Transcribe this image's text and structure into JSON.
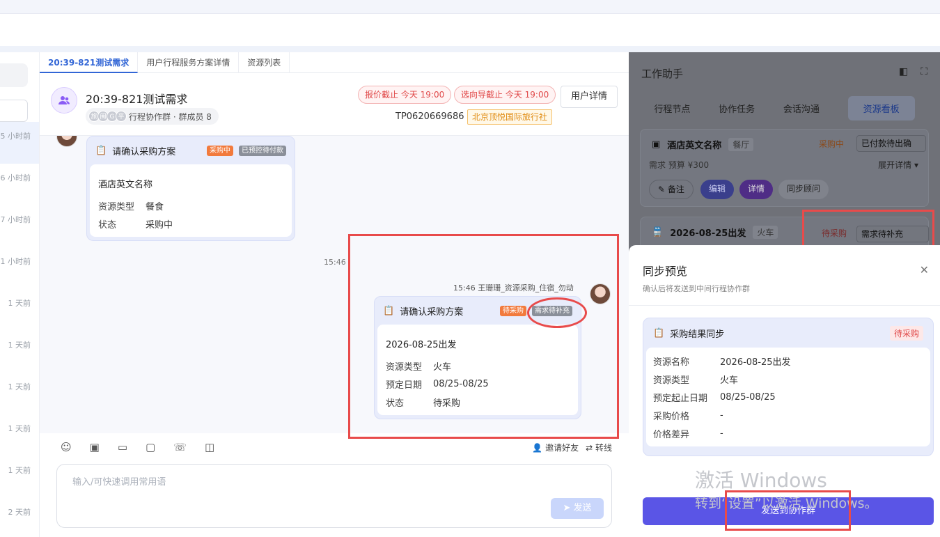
{
  "left_list": {
    "times": [
      "5 小时前",
      "6 小时前",
      "7 小时前",
      "1 小时前",
      "1 天前",
      "1 天前",
      "1 天前",
      "1 天前",
      "1 天前",
      "2 天前"
    ]
  },
  "tabs": [
    "20:39-821测试需求",
    "用户行程服务方案详情",
    "资源列表"
  ],
  "header": {
    "title": "20:39-821测试需求",
    "member_avatars": [
      "旅",
      "闽",
      "G",
      "平"
    ],
    "members": "行程协作群 · 群成员 8",
    "quote_deadline": "报价截止 今天 19:00",
    "guide_deadline": "选向导截止 今天 19:00",
    "user_detail": "用户详情",
    "tp_code": "TP0620669686",
    "agency": "北京顶悦国际旅行社"
  },
  "msg1": {
    "title": "请确认采购方案",
    "tag1": "采购中",
    "tag2": "已预控待付款",
    "name": "酒店英文名称",
    "rows": [
      {
        "k": "资源类型",
        "v": "餐食"
      },
      {
        "k": "状态",
        "v": "采购中"
      }
    ]
  },
  "center_time": "15:46",
  "msg2": {
    "sender": "15:46 王珊珊_资源采购_住宿_勿动",
    "title": "请确认采购方案",
    "tag1": "待采购",
    "tag2": "需求待补充",
    "name": "2026-08-25出发",
    "rows": [
      {
        "k": "资源类型",
        "v": "火车"
      },
      {
        "k": "预定日期",
        "v": "08/25-08/25"
      },
      {
        "k": "状态",
        "v": "待采购"
      }
    ]
  },
  "composer": {
    "invite": "邀请好友",
    "transfer": "转线",
    "placeholder": "输入/可快速调用常用语",
    "send": "发送"
  },
  "work": {
    "title": "工作助手",
    "tabs": [
      "行程节点",
      "协作任务",
      "会话沟通",
      "资源看板"
    ],
    "r1": {
      "name": "酒店英文名称",
      "cat": "餐厅",
      "status": "采购中",
      "select": "已付款待出确",
      "budget": "需求 预算 ¥300",
      "expand": "展开详情 ▾",
      "btns": [
        "备注",
        "编辑",
        "详情",
        "同步顾问"
      ]
    },
    "r2": {
      "name": "2026-08-25出发",
      "cat": "火车",
      "status": "待采购",
      "select": "需求待补充"
    }
  },
  "sync": {
    "title": "同步预览",
    "subtitle": "确认后将发送到中间行程协作群",
    "card_title": "采购结果同步",
    "badge": "待采购",
    "rows": [
      {
        "k": "资源名称",
        "v": "2026-08-25出发"
      },
      {
        "k": "资源类型",
        "v": "火车"
      },
      {
        "k": "预定起止日期",
        "v": "08/25-08/25"
      },
      {
        "k": "采购价格",
        "v": "-"
      },
      {
        "k": "价格差异",
        "v": "-"
      }
    ],
    "send": "发送到协作群"
  },
  "watermark": {
    "line1": "激活 Windows",
    "line2": "转到“设置”以激活 Windows。"
  }
}
